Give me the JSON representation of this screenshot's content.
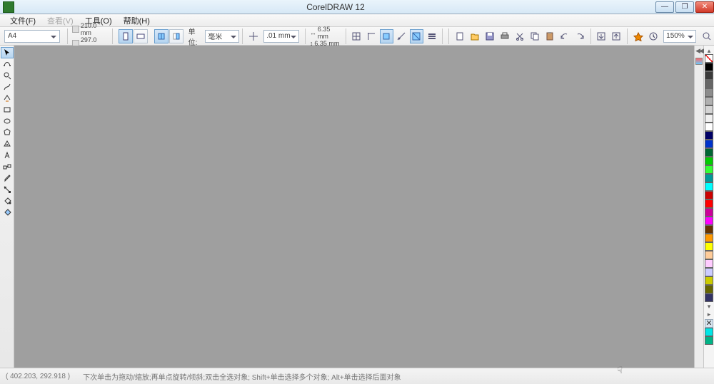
{
  "titlebar": {
    "title": "CorelDRAW 12"
  },
  "menu": {
    "file": "文件(F)",
    "view": "查看(V)",
    "tools": "工具(O)",
    "help": "帮助(H)"
  },
  "propbar": {
    "paper": "A4",
    "width": "210.0 mm",
    "height": "297.0 mm",
    "unit_label": "单位:",
    "unit_value": "毫米",
    "nudge": ".01 mm",
    "dup_x": "6.35 mm",
    "dup_y": "6.35 mm",
    "zoom": "150%"
  },
  "status": {
    "coords": "( 402.203, 292.918 )",
    "hint": "下次单击为拖动/缩放;再单点旋转/倾斜;双击全选对象; Shift+单击选择多个对象; Alt+单击选择后面对象"
  },
  "palette": {
    "colors": [
      "#000000",
      "#3a3a3a",
      "#666666",
      "#8c8c8c",
      "#b0b0b0",
      "#d4d4d4",
      "#f0f0f0",
      "#ffffff",
      "#000066",
      "#0033cc",
      "#006633",
      "#00cc00",
      "#33ff33",
      "#009999",
      "#00ffff",
      "#cc0000",
      "#ff0000",
      "#cc0099",
      "#ff00ff",
      "#663300",
      "#ff9900",
      "#ffff00",
      "#ffcc99",
      "#ffccff",
      "#ccccff",
      "#cccc00",
      "#666600",
      "#333366"
    ]
  },
  "sidecolors": {
    "a": "#00e6e6",
    "b": "#00b386"
  }
}
